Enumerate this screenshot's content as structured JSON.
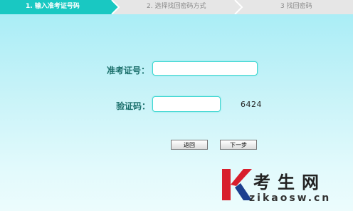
{
  "steps": [
    {
      "label": "1. 输入准考证号码",
      "active": true
    },
    {
      "label": "2. 选择找回密码方式",
      "active": false
    },
    {
      "label": "3 找回密码",
      "active": false
    }
  ],
  "colors": {
    "active_step": "#19c8c2",
    "inactive_step": "#e6e6e6",
    "label_text": "#1a6f6b",
    "input_border": "#3fd7d2"
  },
  "form": {
    "exam_id_label": "准考证号：",
    "exam_id_value": "",
    "captcha_label": "验证码：",
    "captcha_value": "",
    "captcha_text": "6424"
  },
  "buttons": {
    "back_label": "返回",
    "next_label": "下一步"
  },
  "logo": {
    "mark": "K",
    "cn_text": "考生网",
    "en_text": "zikaosw.cn"
  }
}
